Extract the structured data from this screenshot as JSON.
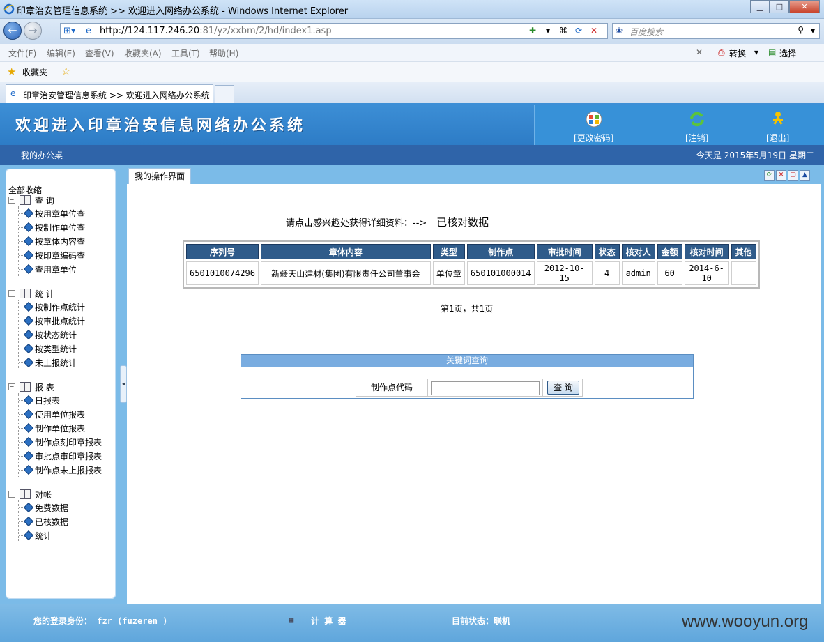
{
  "window": {
    "title": "印章治安管理信息系统 >> 欢迎进入网络办公系统 - Windows Internet Explorer"
  },
  "browser": {
    "url_host": "http://124.117.246.20",
    "url_rest": ":81/yz/xxbm/2/hd/index1.asp",
    "search_placeholder": "百度搜索",
    "menu": [
      "文件(F)",
      "编辑(E)",
      "查看(V)",
      "收藏夹(A)",
      "工具(T)",
      "帮助(H)"
    ],
    "menu_right": {
      "convert": "转换",
      "select": "选择"
    },
    "favorites_label": "收藏夹",
    "tab_title": "印章治安管理信息系统 >> 欢迎进入网络办公系统"
  },
  "app": {
    "banner": "欢迎进入印章治安信息网络办公系统",
    "buttons": {
      "change_password": "[更改密码]",
      "logout": "[注销]",
      "exit": "[退出]"
    },
    "subbar_left": "我的办公桌",
    "subbar_right": "今天是 2015年5月19日 星期二"
  },
  "sidebar": {
    "all": "全部收缩",
    "groups": [
      {
        "title": "查 询",
        "items": [
          "按用章单位查",
          "按制作单位查",
          "按章体内容查",
          "按印章编码查",
          "查用章单位"
        ]
      },
      {
        "title": "统 计",
        "items": [
          "按制作点统计",
          "按审批点统计",
          "按状态统计",
          "按类型统计",
          "未上报统计"
        ]
      },
      {
        "title": "报 表",
        "items": [
          "日报表",
          "使用单位报表",
          "制作单位报表",
          "制作点刻印章报表",
          "审批点审印章报表",
          "制作点未上报报表"
        ]
      },
      {
        "title": "对帐",
        "items": [
          "免费数据",
          "已核数据",
          "统计"
        ]
      }
    ]
  },
  "content": {
    "tab": "我的操作界面",
    "prompt": "请点击感兴趣处获得详细资料：-->",
    "prompt_title": "已核对数据",
    "table": {
      "headers": [
        "序列号",
        "章体内容",
        "类型",
        "制作点",
        "审批时间",
        "状态",
        "核对人",
        "金额",
        "核对时间",
        "其他"
      ],
      "rows": [
        [
          "6501010074296",
          "新疆天山建材(集团)有限责任公司董事会",
          "单位章",
          "650101000014",
          "2012-10-15",
          "4",
          "admin",
          "60",
          "2014-6-10",
          ""
        ]
      ]
    },
    "pager": "第1页，共1页",
    "keyword": {
      "header": "关键词查询",
      "label": "制作点代码",
      "value": "",
      "button": "查 询"
    }
  },
  "footer": {
    "identity": "您的登录身份： fzr (fuzeren )",
    "calculator": "计 算 器",
    "status": "目前状态：联机"
  },
  "watermark": "www.wooyun.org"
}
